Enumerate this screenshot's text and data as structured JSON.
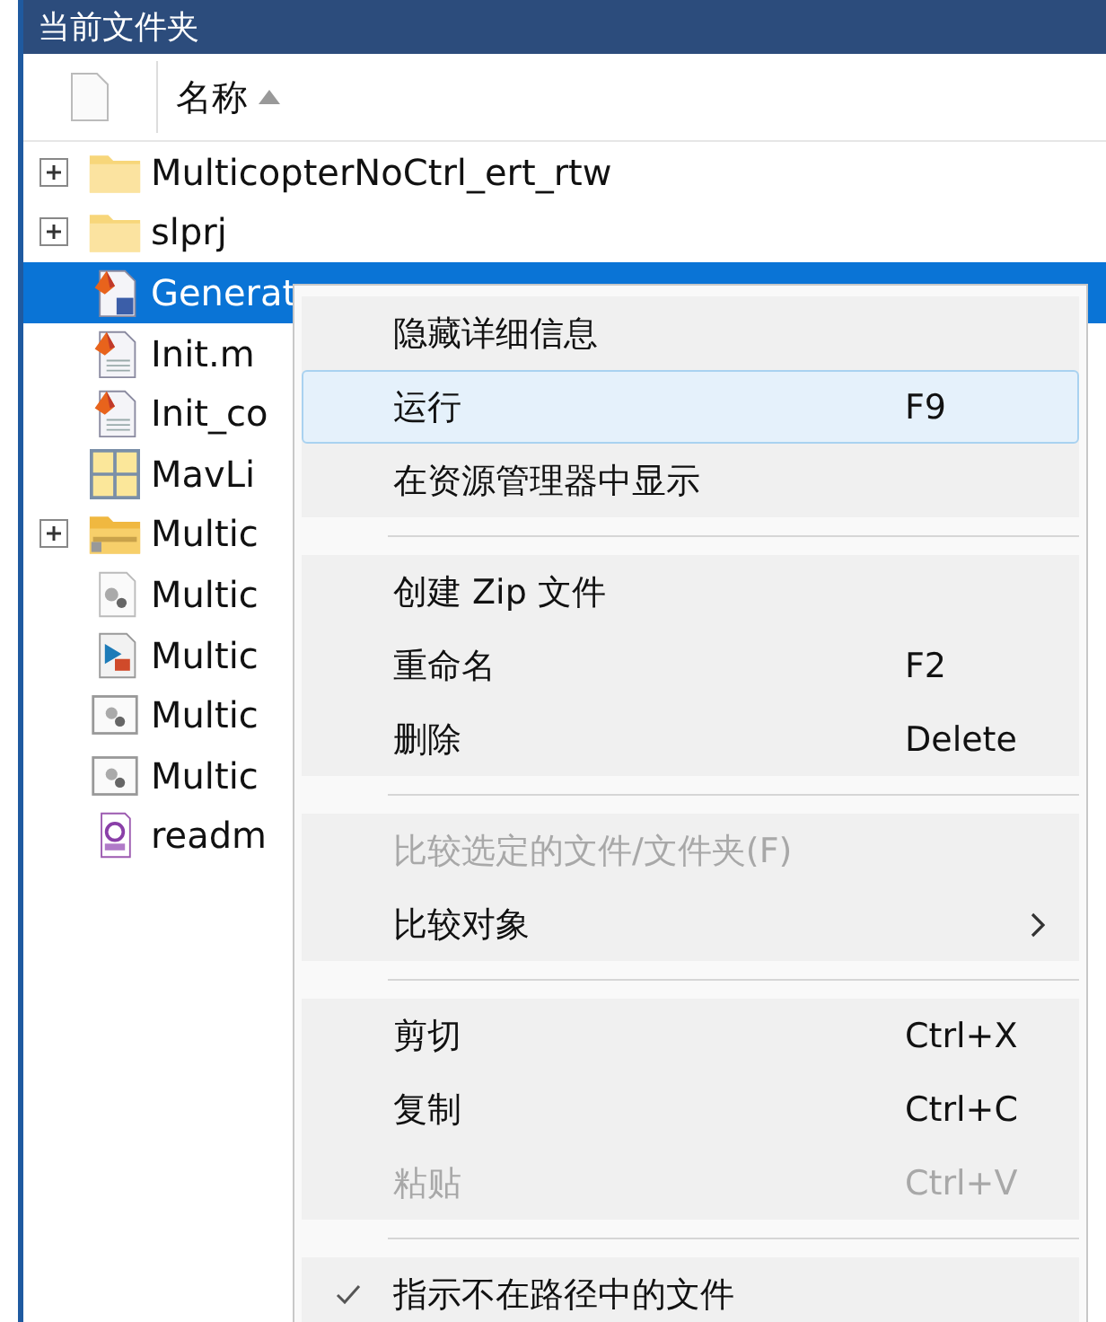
{
  "panel": {
    "title": "当前文件夹",
    "column": {
      "label": "名称",
      "ascending": true
    }
  },
  "files": [
    {
      "name": "MulticopterNoCtrl_ert_rtw",
      "kind": "folder",
      "expandable": true,
      "selected": false
    },
    {
      "name": "slprj",
      "kind": "folder",
      "expandable": true,
      "selected": false
    },
    {
      "name": "Generat",
      "kind": "pfile",
      "expandable": false,
      "selected": true
    },
    {
      "name": "Init.m",
      "kind": "mfile",
      "expandable": false,
      "selected": false
    },
    {
      "name": "Init_co",
      "kind": "mfile",
      "expandable": false,
      "selected": false
    },
    {
      "name": "MavLi",
      "kind": "grid",
      "expandable": false,
      "selected": false
    },
    {
      "name": "Multic",
      "kind": "package",
      "expandable": true,
      "selected": false
    },
    {
      "name": "Multic",
      "kind": "model",
      "expandable": false,
      "selected": false
    },
    {
      "name": "Multic",
      "kind": "runmodel",
      "expandable": false,
      "selected": false
    },
    {
      "name": "Multic",
      "kind": "modelbox",
      "expandable": false,
      "selected": false
    },
    {
      "name": "Multic",
      "kind": "modelbox",
      "expandable": false,
      "selected": false
    },
    {
      "name": "readm",
      "kind": "doc",
      "expandable": false,
      "selected": false
    }
  ],
  "menu": {
    "groups": [
      {
        "items": [
          {
            "label": "隐藏详细信息",
            "selected": false,
            "disabled": false
          },
          {
            "label": "运行",
            "shortcut": "F9",
            "selected": true,
            "disabled": false
          },
          {
            "label": "在资源管理器中显示",
            "selected": false,
            "disabled": false
          }
        ]
      },
      {
        "items": [
          {
            "label": "创建 Zip 文件",
            "selected": false,
            "disabled": false
          },
          {
            "label": "重命名",
            "shortcut": "F2",
            "selected": false,
            "disabled": false
          },
          {
            "label": "删除",
            "shortcut": "Delete",
            "selected": false,
            "disabled": false
          }
        ]
      },
      {
        "items": [
          {
            "label": "比较选定的文件/文件夹(F)",
            "selected": false,
            "disabled": true
          },
          {
            "label": "比较对象",
            "submenu": true,
            "selected": false,
            "disabled": false
          }
        ]
      },
      {
        "items": [
          {
            "label": "剪切",
            "shortcut": "Ctrl+X",
            "selected": false,
            "disabled": false
          },
          {
            "label": "复制",
            "shortcut": "Ctrl+C",
            "selected": false,
            "disabled": false
          },
          {
            "label": "粘贴",
            "shortcut": "Ctrl+V",
            "selected": false,
            "disabled": true
          }
        ]
      },
      {
        "items": [
          {
            "label": "指示不在路径中的文件",
            "checked": true,
            "selected": false,
            "disabled": false
          }
        ]
      }
    ]
  }
}
